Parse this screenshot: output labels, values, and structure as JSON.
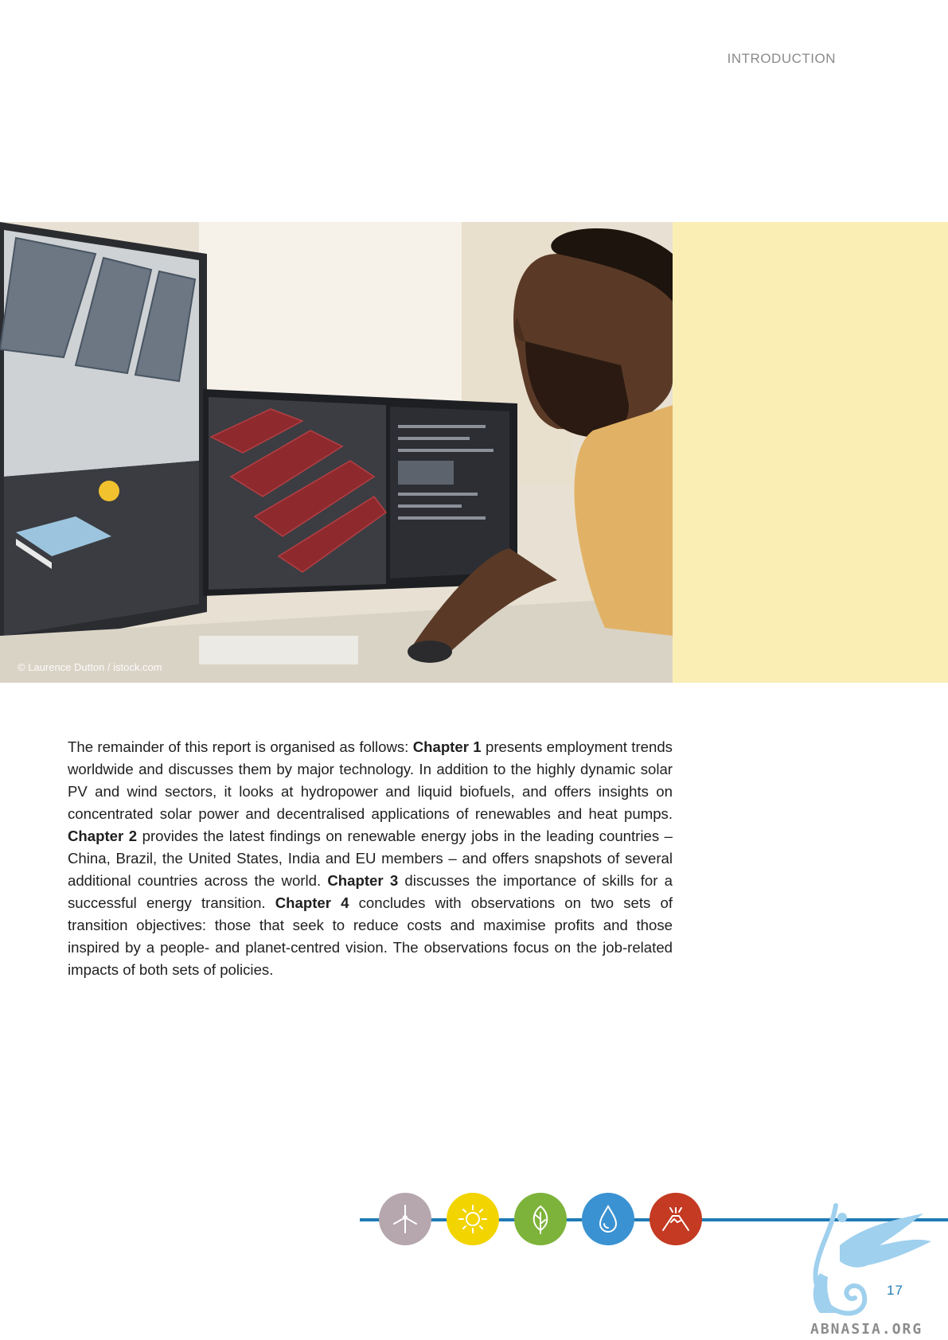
{
  "header": {
    "section": "INTRODUCTION"
  },
  "hero": {
    "credit": "© Laurence Dutton / istock.com"
  },
  "body": {
    "p1_a": "The remainder of this report is organised as follows: ",
    "chapter1": "Chapter 1",
    "p1_b": " presents employment trends worldwide and discusses them by major technology. In addition to the highly dynamic solar PV and wind sectors, it looks at hydropower and liquid biofuels, and offers insights on concentrated solar power and decentralised applications of renewables and heat pumps. ",
    "chapter2": "Chapter 2",
    "p1_c": " provides the latest findings on renewable energy jobs in the leading countries – China, Brazil, the United States, India and EU members – and offers snapshots of several additional countries across the world. ",
    "chapter3": "Chapter 3",
    "p1_d": " discusses the importance of skills for a successful energy transition. ",
    "chapter4": "Chapter 4",
    "p1_e": " concludes with observations on two sets of transition objectives: those that seek to reduce costs and maximise profits and those inspired by a people- and planet-centred vision. The observations focus on the job-related impacts of both sets of policies."
  },
  "footer": {
    "icons": [
      {
        "name": "wind-turbine-icon",
        "color": "#b6a6ad"
      },
      {
        "name": "sun-icon",
        "color": "#f2d400"
      },
      {
        "name": "leaf-icon",
        "color": "#7db33a"
      },
      {
        "name": "water-drop-icon",
        "color": "#3a92d2"
      },
      {
        "name": "volcano-icon",
        "color": "#c43a22"
      }
    ],
    "page_number": "17",
    "watermark": "ABNASIA.ORG"
  },
  "colors": {
    "accent_blue": "#1f7bb4",
    "panel_yellow": "#fbeeb4"
  }
}
